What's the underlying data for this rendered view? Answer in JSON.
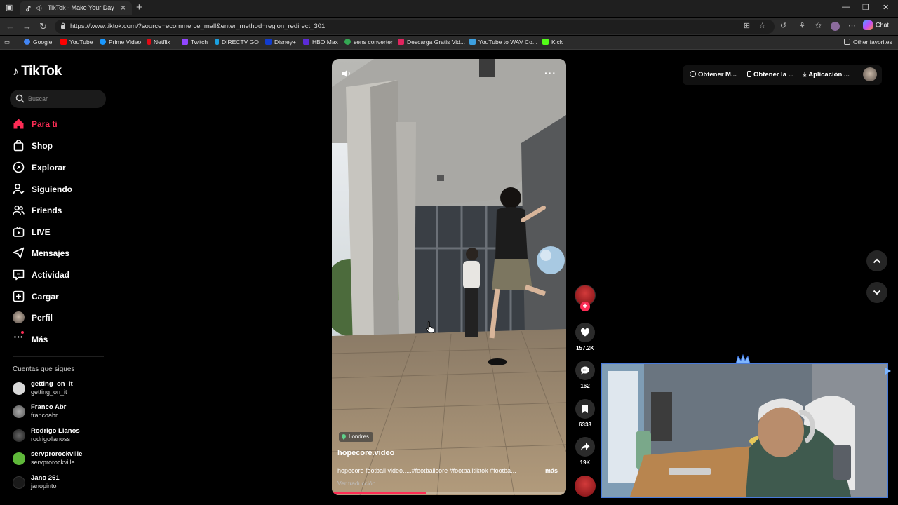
{
  "browser": {
    "tab_title": "TikTok - Make Your Day",
    "url": "https://www.tiktok.com/?source=ecommerce_mall&enter_method=region_redirect_301",
    "chat_label": "Chat",
    "bookmarks": [
      {
        "label": "Google",
        "color": "#4285f4"
      },
      {
        "label": "YouTube",
        "color": "#ff0000"
      },
      {
        "label": "Prime Video",
        "color": "#1a98ff"
      },
      {
        "label": "Netflix",
        "color": "#e50914"
      },
      {
        "label": "Twitch",
        "color": "#9146ff"
      },
      {
        "label": "DIRECTV GO",
        "color": "#1aa0e0"
      },
      {
        "label": "Disney+",
        "color": "#113ccf"
      },
      {
        "label": "HBO Max",
        "color": "#5b2bd8"
      },
      {
        "label": "sens converter",
        "color": "#34a853"
      },
      {
        "label": "Descarga Gratis Vid...",
        "color": "#e0245e"
      },
      {
        "label": "YouTube to WAV Co...",
        "color": "#3da0e0"
      },
      {
        "label": "Kick",
        "color": "#53fc18"
      }
    ],
    "other_favorites": "Other favorites"
  },
  "tiktok": {
    "logo": "TikTok",
    "search_placeholder": "Buscar",
    "nav": [
      {
        "label": "Para ti",
        "icon": "home-icon",
        "active": true
      },
      {
        "label": "Shop",
        "icon": "shop-bag-icon"
      },
      {
        "label": "Explorar",
        "icon": "compass-icon"
      },
      {
        "label": "Siguiendo",
        "icon": "following-user-icon"
      },
      {
        "label": "Friends",
        "icon": "friends-icon"
      },
      {
        "label": "LIVE",
        "icon": "live-tv-icon"
      },
      {
        "label": "Mensajes",
        "icon": "messages-icon"
      },
      {
        "label": "Actividad",
        "icon": "activity-icon"
      },
      {
        "label": "Cargar",
        "icon": "upload-plus-icon"
      },
      {
        "label": "Perfil",
        "icon": "profile-avatar-icon"
      },
      {
        "label": "Más",
        "icon": "more-dots-icon"
      }
    ],
    "following_title": "Cuentas que sigues",
    "accounts": [
      {
        "name": "getting_on_it",
        "handle": "getting_on_it",
        "color": "#d9d9d9"
      },
      {
        "name": "Franco Abr",
        "handle": "francoabr",
        "color": "#8a8a8a"
      },
      {
        "name": "Rodrigo Llanos",
        "handle": "rodrigollanoss",
        "color": "#2a2a2a"
      },
      {
        "name": "servprorockville",
        "handle": "servprorockville",
        "color": "#5fb83a"
      },
      {
        "name": "Jano 261",
        "handle": "janopinto",
        "color": "#1a1a1a"
      }
    ],
    "video": {
      "location": "Londres",
      "author": "hopecore.video",
      "description": "hopecore football video.....#footballcore #footballtiktok #footba...",
      "more": "más",
      "translate": "Ver traducción",
      "progress": 0.4
    },
    "actions": {
      "likes": "157.2K",
      "comments": "162",
      "saves": "6333",
      "shares": "19K"
    },
    "top_right": {
      "coins": "Obtener M...",
      "app": "Obtener la ...",
      "desktop": "Aplicación ..."
    }
  }
}
